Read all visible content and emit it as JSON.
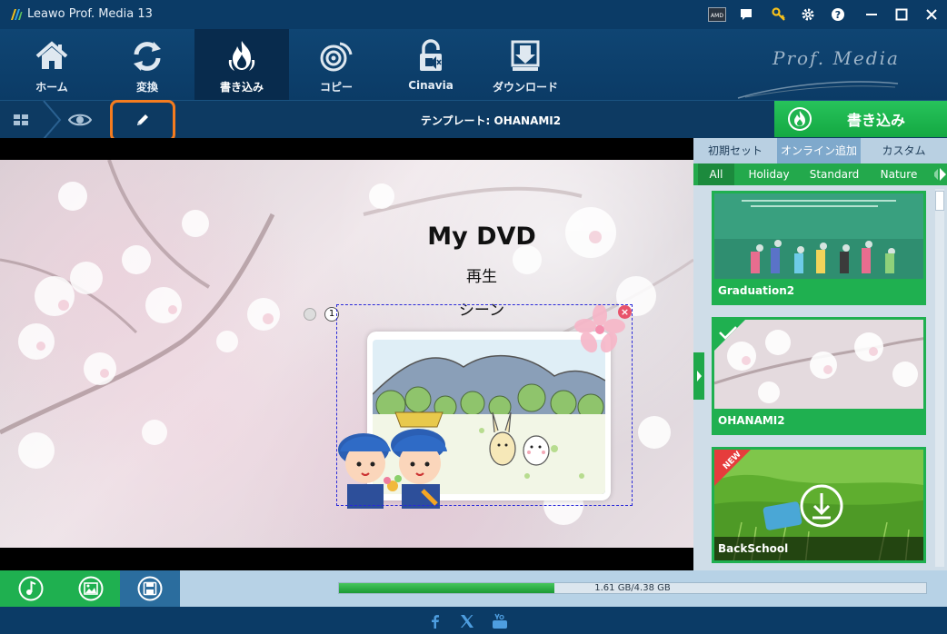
{
  "titlebar": {
    "title": "Leawo Prof. Media 13",
    "amd_label": "AMD"
  },
  "nav": {
    "items": [
      {
        "label": "ホーム",
        "icon": "home-icon"
      },
      {
        "label": "変換",
        "icon": "convert-icon"
      },
      {
        "label": "書き込み",
        "icon": "burn-icon",
        "active": true
      },
      {
        "label": "コピー",
        "icon": "copy-icon"
      },
      {
        "label": "Cinavia",
        "icon": "cinavia-icon"
      },
      {
        "label": "ダウンロード",
        "icon": "download-icon"
      }
    ],
    "brand": "Prof. Media"
  },
  "subbar": {
    "template_label": "テンプレート: OHANAMI2",
    "burn_label": "書き込み"
  },
  "preview": {
    "page_number": "1",
    "menu_title": "My DVD",
    "play_label": "再生",
    "scene_label": "シーン",
    "close_label": "×"
  },
  "rpanel": {
    "tabs": [
      "初期セット",
      "オンライン追加",
      "カスタム"
    ],
    "active_tab": 1,
    "categories": [
      "All",
      "Holiday",
      "Standard",
      "Nature"
    ],
    "active_category": 0,
    "templates": [
      {
        "name": "Graduation2"
      },
      {
        "name": "OHANAMI2",
        "selected": true
      },
      {
        "name": "BackSchool",
        "badge": "NEW"
      }
    ]
  },
  "bottombar": {
    "storage_text": "1.61 GB/4.38 GB",
    "used_fraction": 0.3676
  },
  "colors": {
    "accent_green": "#1fb050",
    "highlight_orange": "#f57c1f",
    "nav_bg": "#0b3b66"
  }
}
